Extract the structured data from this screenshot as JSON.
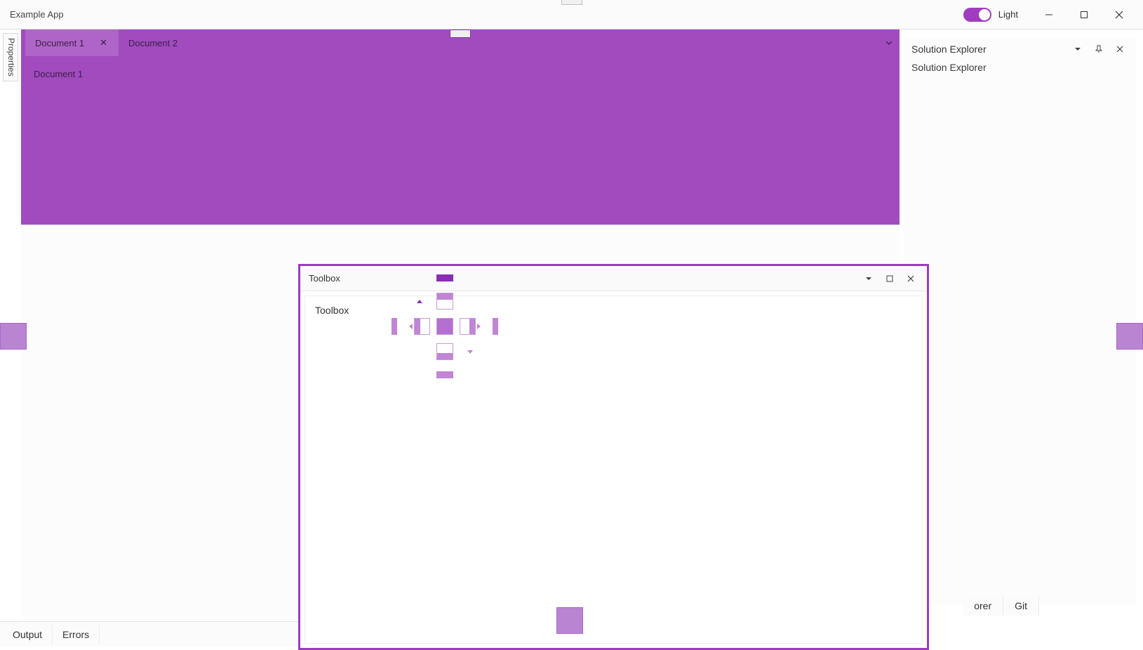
{
  "app": {
    "title": "Example App"
  },
  "theme": {
    "toggle_label": "Light"
  },
  "left_panel": {
    "collapsed_label": "Properties"
  },
  "documents": {
    "tabs": [
      {
        "label": "Document 1",
        "active": true
      },
      {
        "label": "Document 2",
        "active": false
      }
    ],
    "active_body_label": "Document 1"
  },
  "solution_panel": {
    "header": "Solution Explorer",
    "body_label": "Solution Explorer"
  },
  "bottom_tabs": [
    {
      "label": "Output"
    },
    {
      "label": "Errors"
    }
  ],
  "right_bottom_tabs": [
    {
      "label": "orer"
    },
    {
      "label": "Git"
    }
  ],
  "floating": {
    "title": "Toolbox",
    "body_label": "Toolbox"
  },
  "colors": {
    "accent": "#a03cc0",
    "document_fill": "#a14bbf",
    "dock_hint": "#b985d3"
  }
}
